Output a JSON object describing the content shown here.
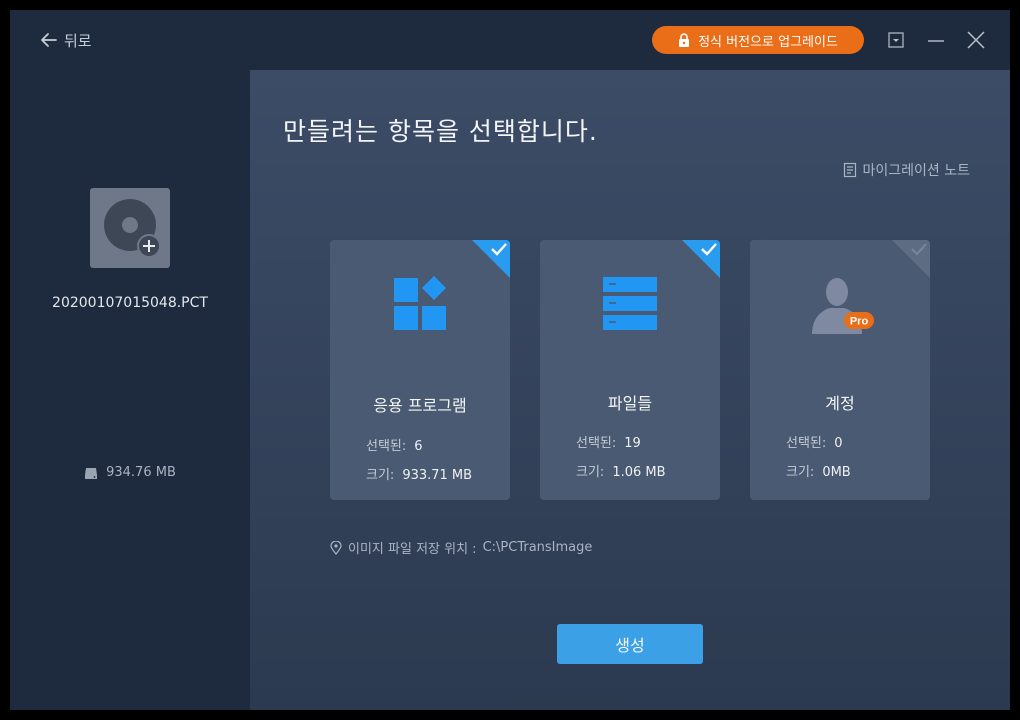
{
  "titlebar": {
    "back_label": "뒤로",
    "upgrade_label": "정식 버전으로 업그레이드"
  },
  "sidebar": {
    "filename": "20200107015048.PCT",
    "size": "934.76 MB"
  },
  "main": {
    "heading": "만들려는 항목을 선택합니다.",
    "notes_label": "마이그레이션 노트",
    "cards": [
      {
        "name": "응용 프로그램",
        "selected_label": "선택된:",
        "selected_value": "6",
        "size_label": "크기:",
        "size_value": "933.71 MB",
        "checked": true,
        "icon": "apps-icon"
      },
      {
        "name": "파일들",
        "selected_label": "선택된:",
        "selected_value": "19",
        "size_label": "크기:",
        "size_value": "1.06 MB",
        "checked": true,
        "icon": "files-icon"
      },
      {
        "name": "계정",
        "selected_label": "선택된:",
        "selected_value": "0",
        "size_label": "크기:",
        "size_value": "0MB",
        "checked": false,
        "icon": "account-pro-icon",
        "badge": "Pro"
      }
    ],
    "location_label": "이미지 파일 저장 위치 :",
    "location_value": "C:\\PCTransImage",
    "create_label": "생성"
  },
  "colors": {
    "accent": "#3ba0e6",
    "upgrade": "#ea6d17",
    "card_bg": "#4a5a72",
    "icon_blue": "#2196f3",
    "background": "#1e2a3d"
  }
}
